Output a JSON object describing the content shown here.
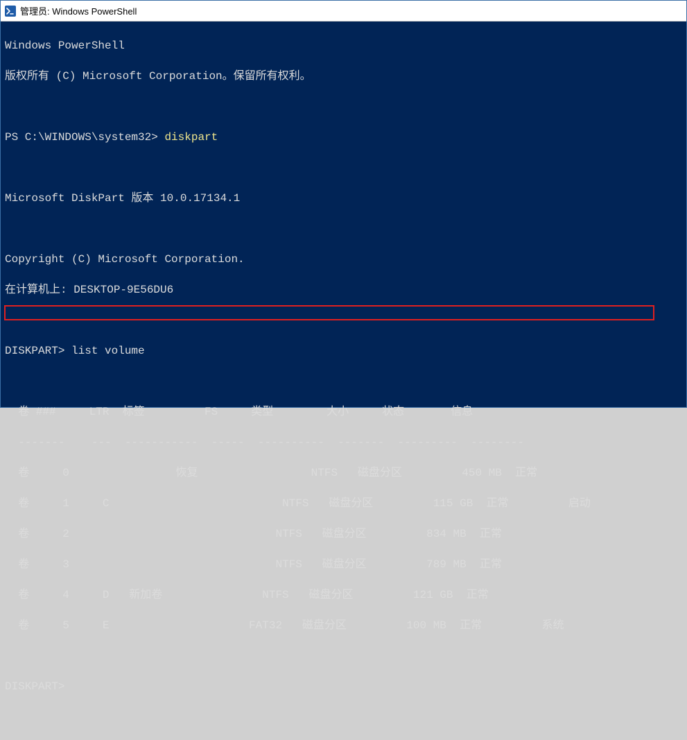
{
  "titlebar": {
    "icon_name": "powershell-icon",
    "title": "管理员: Windows PowerShell"
  },
  "terminal": {
    "header_line1": "Windows PowerShell",
    "header_line2": "版权所有 (C) Microsoft Corporation。保留所有权利。",
    "prompt1_path": "PS C:\\WINDOWS\\system32> ",
    "prompt1_cmd": "diskpart",
    "diskpart_version": "Microsoft DiskPart 版本 10.0.17134.1",
    "copyright": "Copyright (C) Microsoft Corporation.",
    "computer_line": "在计算机上: DESKTOP-9E56DU6",
    "dp_prompt1": "DISKPART> list volume",
    "table_header": "  卷 ###     LTR  标签         FS     类型        大小     状态       信息",
    "table_divider": "  -------    ---  -----------  -----  ----------  -------  ---------  --------",
    "rows": [
      "  卷     0                恢复                 NTFS   磁盘分区         450 MB  正常",
      "  卷     1     C                          NTFS   磁盘分区         115 GB  正常         启动",
      "  卷     2                               NTFS   磁盘分区         834 MB  正常",
      "  卷     3                               NTFS   磁盘分区         789 MB  正常",
      "  卷     4     D   新加卷               NTFS   磁盘分区         121 GB  正常",
      "  卷     5     E                     FAT32   磁盘分区         100 MB  正常         系统"
    ],
    "dp_prompt2": "DISKPART>",
    "volumes_structured": [
      {
        "num": 0,
        "ltr": "",
        "label": "恢复",
        "fs": "NTFS",
        "type": "磁盘分区",
        "size": "450 MB",
        "status": "正常",
        "info": ""
      },
      {
        "num": 1,
        "ltr": "C",
        "label": "",
        "fs": "NTFS",
        "type": "磁盘分区",
        "size": "115 GB",
        "status": "正常",
        "info": "启动"
      },
      {
        "num": 2,
        "ltr": "",
        "label": "",
        "fs": "NTFS",
        "type": "磁盘分区",
        "size": "834 MB",
        "status": "正常",
        "info": ""
      },
      {
        "num": 3,
        "ltr": "",
        "label": "",
        "fs": "NTFS",
        "type": "磁盘分区",
        "size": "789 MB",
        "status": "正常",
        "info": ""
      },
      {
        "num": 4,
        "ltr": "D",
        "label": "新加卷",
        "fs": "NTFS",
        "type": "磁盘分区",
        "size": "121 GB",
        "status": "正常",
        "info": ""
      },
      {
        "num": 5,
        "ltr": "E",
        "label": "",
        "fs": "FAT32",
        "type": "磁盘分区",
        "size": "100 MB",
        "status": "正常",
        "info": "系统"
      }
    ],
    "highlighted_row_index": 5
  }
}
